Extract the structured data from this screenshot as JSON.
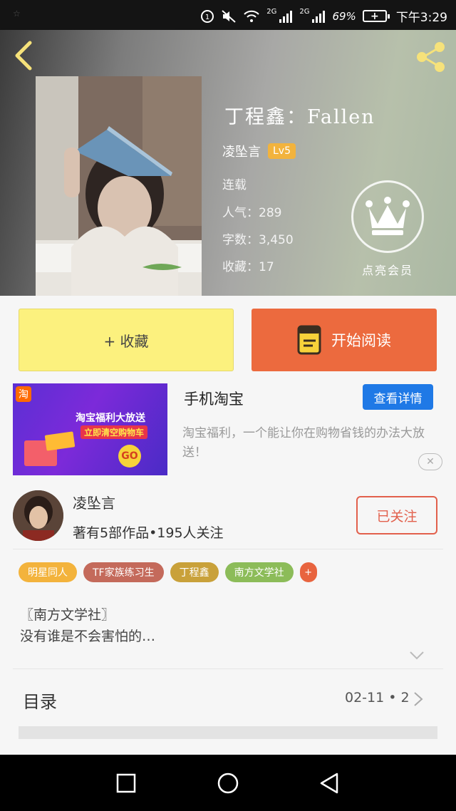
{
  "status_bar": {
    "left_glyph": "☆",
    "network1": "2G",
    "network2": "2G",
    "battery_percent": "69%",
    "time": "下午3:29",
    "icons": [
      "notification-icon",
      "mute-icon",
      "wifi-icon",
      "signal-icon",
      "signal-icon",
      "battery-icon"
    ]
  },
  "header": {
    "back_icon": "chevron-left-icon",
    "share_icon": "share-icon"
  },
  "book": {
    "title": "丁程鑫：Fallen",
    "author": "凌坠言",
    "level": "Lv5",
    "status": "连载",
    "popularity": "人气：289",
    "word_count": "字数：3,450",
    "favorites": "收藏：17",
    "vip_label": "点亮会员"
  },
  "actions": {
    "collect_label": "+ 收藏",
    "read_label": "开始阅读"
  },
  "ad": {
    "logo": "淘",
    "banner_line1": "淘宝福利大放送",
    "banner_line2": "立即清空购物车",
    "banner_go": "GO",
    "title": "手机淘宝",
    "detail_button": "查看详情",
    "description": "淘宝福利，一个能让你在购物省钱的办法大放送！",
    "close": "✕"
  },
  "author_info": {
    "name": "凌坠言",
    "works": "著有5部作品•195人关注",
    "follow_label": "已关注"
  },
  "tags": [
    {
      "label": "明星同人",
      "color": "#f3b33c"
    },
    {
      "label": "TF家族练习生",
      "color": "#c46a5b"
    },
    {
      "label": "丁程鑫",
      "color": "#c9a13a"
    },
    {
      "label": "南方文学社",
      "color": "#8cbc59"
    }
  ],
  "tag_more": "+",
  "description": {
    "line1": "〖南方文学社〗",
    "line2": "没有谁是不会害怕的…"
  },
  "toc": {
    "label": "目录",
    "meta": "02-11 • 2"
  },
  "colors": {
    "accent_orange": "#ec6a3e",
    "collect_yellow": "#fcf17e",
    "blue_button": "#1f79e6",
    "follow_red": "#e2604c"
  }
}
